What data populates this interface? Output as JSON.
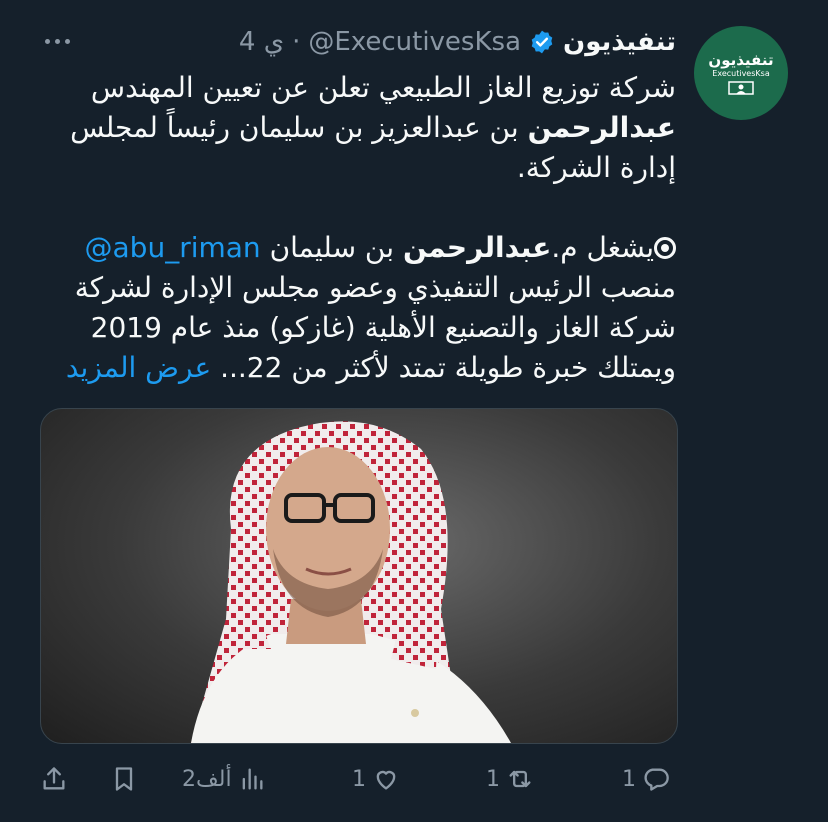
{
  "author": {
    "display_name": "تنفيذيون",
    "handle": "@ExecutivesKsa",
    "separator": "·",
    "time": "4 ي",
    "avatar_title_ar": "تنفيذيون",
    "avatar_title_en": "ExecutivesKsa"
  },
  "tweet": {
    "p1_l1": "شركة توزيع الغاز الطبيعي تعلن عن تعيين المهندس",
    "p1_l2_bold": "عبدالرحمن",
    "p1_l2_rest": " بن عبدالعزيز بن سليمان رئيساً لمجلس",
    "p1_l3": "إدارة الشركة.",
    "p2_l1_a": "يشغل م.",
    "p2_l1_bold": "عبدالرحمن",
    "p2_l1_b": " بن سليمان ",
    "p2_l1_mention": "@abu_riman",
    "p2_l2": "منصب الرئيس التنفيذي وعضو مجلس الإدارة لشركة",
    "p2_l3": "شركة الغاز والتصنيع الأهلية (غازكو) منذ عام 2019",
    "p2_l4": "ويمتلك خبرة طويلة تمتد لأكثر من 22... ",
    "show_more": "عرض المزيد"
  },
  "actions": {
    "reply_count": "1",
    "retweet_count": "1",
    "like_count": "1",
    "views_count": "2ألف"
  },
  "colors": {
    "background": "#15202b",
    "text": "#f7f9f9",
    "muted": "#8b98a5",
    "link": "#1d9bf0",
    "avatar": "#1c6b4c"
  },
  "icons": [
    "more-icon",
    "verified-badge-icon",
    "reply-icon",
    "retweet-icon",
    "like-icon",
    "views-icon",
    "bookmark-icon",
    "share-icon"
  ]
}
